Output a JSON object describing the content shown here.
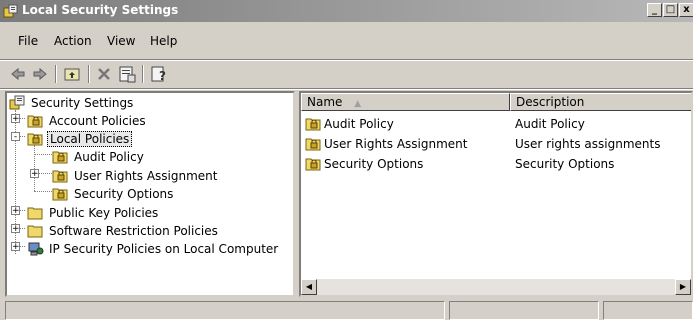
{
  "window": {
    "title": "Local Security Settings",
    "buttons": {
      "minimize": "_",
      "maximize": "□",
      "close": "x"
    }
  },
  "menu": [
    "File",
    "Action",
    "View",
    "Help"
  ],
  "toolbar": [
    "back-icon",
    "forward-icon",
    "up-folder-icon",
    "delete-icon",
    "properties-icon",
    "help-icon"
  ],
  "tree": [
    {
      "label": "Security Settings",
      "level": 0,
      "icon": "security-settings-icon"
    },
    {
      "label": "Account Policies",
      "level": 1,
      "icon": "lock-folder-icon",
      "expander": "+"
    },
    {
      "label": "Local Policies",
      "level": 1,
      "icon": "lock-folder-icon",
      "expander": "-",
      "selected": true
    },
    {
      "label": "Audit Policy",
      "level": 2,
      "icon": "lock-folder-icon"
    },
    {
      "label": "User Rights Assignment",
      "level": 2,
      "icon": "lock-folder-icon",
      "expander": "+"
    },
    {
      "label": "Security Options",
      "level": 2,
      "icon": "lock-folder-icon"
    },
    {
      "label": "Public Key Policies",
      "level": 1,
      "icon": "folder-icon",
      "expander": "+"
    },
    {
      "label": "Software Restriction Policies",
      "level": 1,
      "icon": "folder-icon",
      "expander": "+"
    },
    {
      "label": "IP Security Policies on Local Computer",
      "level": 1,
      "icon": "ip-security-icon",
      "expander": "+"
    }
  ],
  "list": {
    "columns": [
      "Name",
      "Description"
    ],
    "sort_indicator": "▲",
    "rows": [
      {
        "name": "Audit Policy",
        "description": "Audit Policy"
      },
      {
        "name": "User Rights Assignment",
        "description": "User rights assignments"
      },
      {
        "name": "Security Options",
        "description": "Security Options"
      }
    ]
  },
  "colors": {
    "titlebar": "#8a8a8a",
    "window": "#d4d0c8",
    "pane": "#ffffff"
  }
}
